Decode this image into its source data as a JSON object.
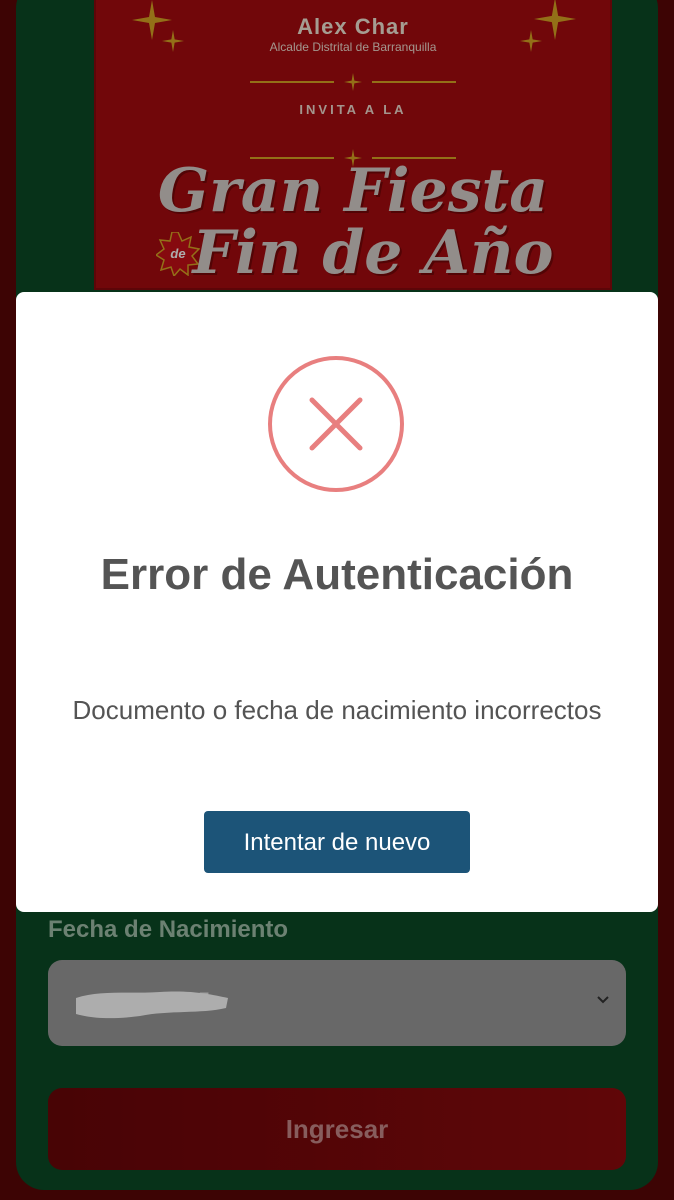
{
  "banner": {
    "name": "Alex Char",
    "title": "Alcalde Distrital de Barranquilla",
    "invite": "INVITA A LA",
    "headline_line1": "Gran Fiesta",
    "headline_connector": "de",
    "headline_line2": "Fin de Año"
  },
  "form": {
    "date_label": "Fecha de Nacimiento",
    "date_value_partial": "5",
    "submit_label": "Ingresar"
  },
  "modal": {
    "title": "Error de Autenticación",
    "message": "Documento o fecha de nacimiento incorrectos",
    "button_label": "Intentar de nuevo",
    "icon": "error-x-icon"
  },
  "colors": {
    "page_red": "#5a0707",
    "panel_green": "#0b4a25",
    "banner_red": "#a70b10",
    "gold": "#d9a524",
    "error_accent": "#e87f7f",
    "button_blue": "#1c5478"
  }
}
